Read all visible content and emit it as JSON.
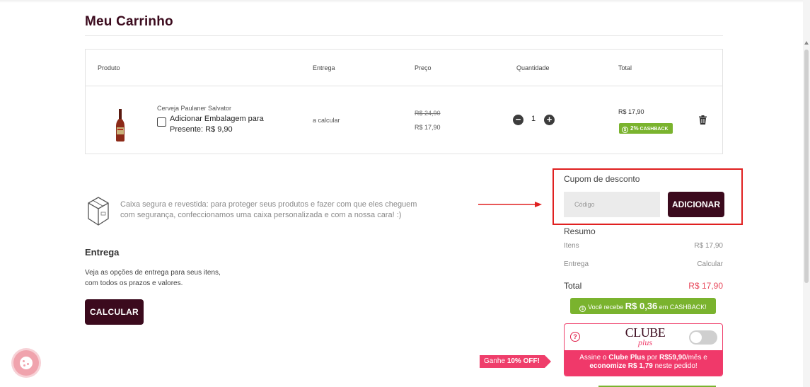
{
  "page": {
    "title": "Meu Carrinho"
  },
  "table": {
    "headers": {
      "produto": "Produto",
      "entrega": "Entrega",
      "preco": "Preço",
      "quantidade": "Quantidade",
      "total": "Total"
    },
    "item": {
      "name": "Cerveja Paulaner Salvator",
      "gift_label": "Adicionar Embalagem para Presente: R$ 9,90",
      "delivery": "a calcular",
      "old_price": "R$ 24,90",
      "price": "R$ 17,90",
      "quantity": "1",
      "total": "R$ 17,90",
      "cashback_percent": "2%",
      "cashback_label": "CASHBACK"
    }
  },
  "secure_box": {
    "text": "Caixa segura e revestida: para proteger seus produtos e fazer com que eles cheguem com segurança, confeccionamos uma caixa personalizada e com a nossa cara! :)"
  },
  "delivery": {
    "title": "Entrega",
    "description": "Veja as opções de entrega para seus itens, com todos os prazos e valores.",
    "button": "CALCULAR"
  },
  "coupon": {
    "title": "Cupom de desconto",
    "placeholder": "Código",
    "button": "ADICIONAR"
  },
  "summary": {
    "title": "Resumo",
    "itens_label": "Itens",
    "itens_value": "R$ 17,90",
    "entrega_label": "Entrega",
    "entrega_value": "Calcular",
    "total_label": "Total",
    "total_value": "R$ 17,90"
  },
  "cashback": {
    "prefix": "Você recebe",
    "amount": "R$ 0,36",
    "suffix": "em CASHBACK!"
  },
  "clube": {
    "logo_line1": "CLUBE",
    "logo_line2": "plus",
    "line1_a": "Assine o",
    "line1_b": "Clube Plus",
    "line1_c": "por",
    "line1_d": "R$59,90",
    "line1_e": "/mês e",
    "line2_a": "economize",
    "line2_b": "R$ 1,79",
    "line2_c": "neste pedido!",
    "toggle_on": false
  },
  "ganhe": {
    "prefix": "Ganhe",
    "highlight": "10% OFF!"
  },
  "colors": {
    "brand": "#3b0a1d",
    "accent_pink": "#ef3e6b",
    "cashback_green": "#7ab32e",
    "coupon_border": "#e02020"
  },
  "icons": [
    "bottle-image",
    "checkbox",
    "minus-icon",
    "plus-icon",
    "trash-icon",
    "box-icon",
    "arrow-icon",
    "coin-icon",
    "help-icon",
    "cookie-icon"
  ]
}
